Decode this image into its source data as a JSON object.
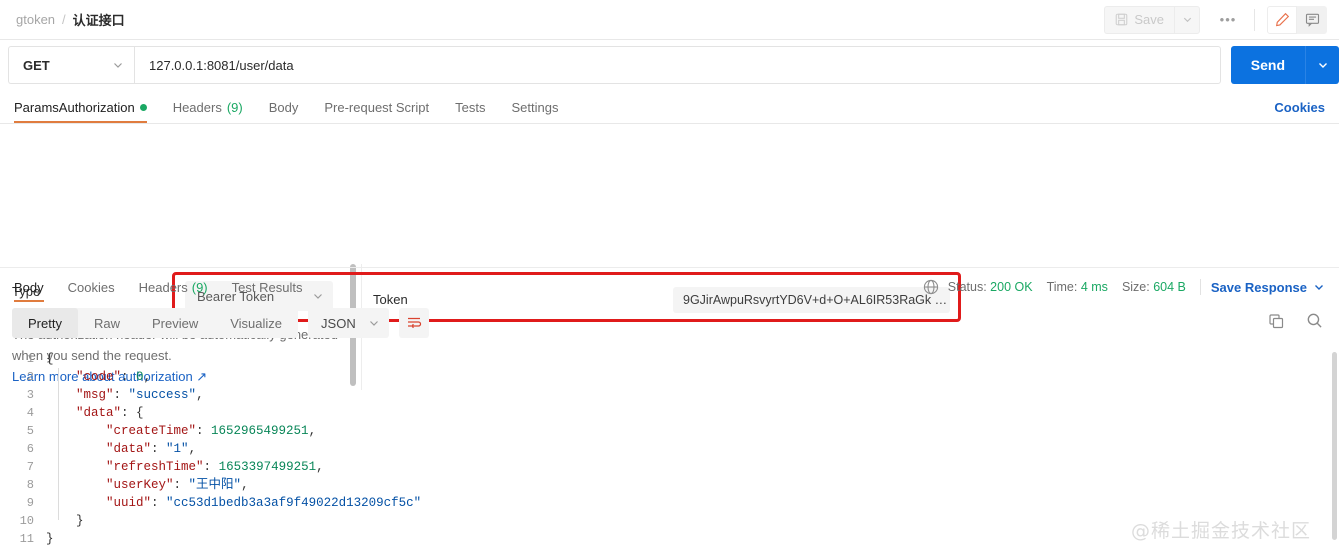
{
  "topbar": {
    "breadcrumb_root": "gtoken",
    "breadcrumb_sep": "/",
    "breadcrumb_current": "认证接口",
    "save_label": "Save",
    "more_label": "•••",
    "edit_icon_name": "pencil-icon",
    "comment_icon_name": "comment-icon"
  },
  "request": {
    "method": "GET",
    "url": "127.0.0.1:8081/user/data",
    "send_label": "Send"
  },
  "request_tabs": [
    {
      "label": "Params",
      "active": false,
      "dot": false,
      "count": ""
    },
    {
      "label": "Authorization",
      "active": true,
      "dot": true,
      "count": ""
    },
    {
      "label": "Headers",
      "active": false,
      "dot": false,
      "count": "(9)"
    },
    {
      "label": "Body",
      "active": false,
      "dot": false,
      "count": ""
    },
    {
      "label": "Pre-request Script",
      "active": false,
      "dot": false,
      "count": ""
    },
    {
      "label": "Tests",
      "active": false,
      "dot": false,
      "count": ""
    },
    {
      "label": "Settings",
      "active": false,
      "dot": false,
      "count": ""
    }
  ],
  "cookies_link": "Cookies",
  "auth": {
    "type_label": "Type",
    "type_value": "Bearer Token",
    "helper_text": "The authorization header will be automatically generated when you send the request.",
    "learn_more": "Learn more about authorization ↗",
    "token_label": "Token",
    "token_value": "9GJirAwpuRsvyrtYD6V+d+O+AL6IR53RaGk …",
    "highlight_color": "#e01b1b"
  },
  "response_tabs": [
    {
      "label": "Body",
      "active": true,
      "count": ""
    },
    {
      "label": "Cookies",
      "active": false,
      "count": ""
    },
    {
      "label": "Headers",
      "active": false,
      "count": "(9)"
    },
    {
      "label": "Test Results",
      "active": false,
      "count": ""
    }
  ],
  "response_meta": {
    "status_label": "Status:",
    "status_value": "200 OK",
    "time_label": "Time:",
    "time_value": "4 ms",
    "size_label": "Size:",
    "size_value": "604 B",
    "save_response": "Save Response"
  },
  "format_tabs": [
    {
      "label": "Pretty",
      "active": true
    },
    {
      "label": "Raw",
      "active": false
    },
    {
      "label": "Preview",
      "active": false
    },
    {
      "label": "Visualize",
      "active": false
    }
  ],
  "format_select": "JSON",
  "code_lines": [
    {
      "num": "1",
      "segments": [
        {
          "t": "{",
          "c": "p"
        }
      ]
    },
    {
      "num": "2",
      "segments": [
        {
          "t": "    ",
          "c": "p"
        },
        {
          "t": "\"code\"",
          "c": "k"
        },
        {
          "t": ": ",
          "c": "p"
        },
        {
          "t": "0",
          "c": "n"
        },
        {
          "t": ",",
          "c": "p"
        }
      ]
    },
    {
      "num": "3",
      "segments": [
        {
          "t": "    ",
          "c": "p"
        },
        {
          "t": "\"msg\"",
          "c": "k"
        },
        {
          "t": ": ",
          "c": "p"
        },
        {
          "t": "\"success\"",
          "c": "s"
        },
        {
          "t": ",",
          "c": "p"
        }
      ]
    },
    {
      "num": "4",
      "segments": [
        {
          "t": "    ",
          "c": "p"
        },
        {
          "t": "\"data\"",
          "c": "k"
        },
        {
          "t": ": {",
          "c": "p"
        }
      ]
    },
    {
      "num": "5",
      "segments": [
        {
          "t": "        ",
          "c": "p"
        },
        {
          "t": "\"createTime\"",
          "c": "k"
        },
        {
          "t": ": ",
          "c": "p"
        },
        {
          "t": "1652965499251",
          "c": "n"
        },
        {
          "t": ",",
          "c": "p"
        }
      ]
    },
    {
      "num": "6",
      "segments": [
        {
          "t": "        ",
          "c": "p"
        },
        {
          "t": "\"data\"",
          "c": "k"
        },
        {
          "t": ": ",
          "c": "p"
        },
        {
          "t": "\"1\"",
          "c": "s"
        },
        {
          "t": ",",
          "c": "p"
        }
      ]
    },
    {
      "num": "7",
      "segments": [
        {
          "t": "        ",
          "c": "p"
        },
        {
          "t": "\"refreshTime\"",
          "c": "k"
        },
        {
          "t": ": ",
          "c": "p"
        },
        {
          "t": "1653397499251",
          "c": "n"
        },
        {
          "t": ",",
          "c": "p"
        }
      ]
    },
    {
      "num": "8",
      "segments": [
        {
          "t": "        ",
          "c": "p"
        },
        {
          "t": "\"userKey\"",
          "c": "k"
        },
        {
          "t": ": ",
          "c": "p"
        },
        {
          "t": "\"王中阳\"",
          "c": "s"
        },
        {
          "t": ",",
          "c": "p"
        }
      ]
    },
    {
      "num": "9",
      "segments": [
        {
          "t": "        ",
          "c": "p"
        },
        {
          "t": "\"uuid\"",
          "c": "k"
        },
        {
          "t": ": ",
          "c": "p"
        },
        {
          "t": "\"cc53d1bedb3a3af9f49022d13209cf5c\"",
          "c": "s"
        }
      ]
    },
    {
      "num": "10",
      "segments": [
        {
          "t": "    }",
          "c": "p"
        }
      ]
    },
    {
      "num": "11",
      "segments": [
        {
          "t": "}",
          "c": "p"
        }
      ]
    }
  ],
  "watermark": "@稀土掘金技术社区"
}
